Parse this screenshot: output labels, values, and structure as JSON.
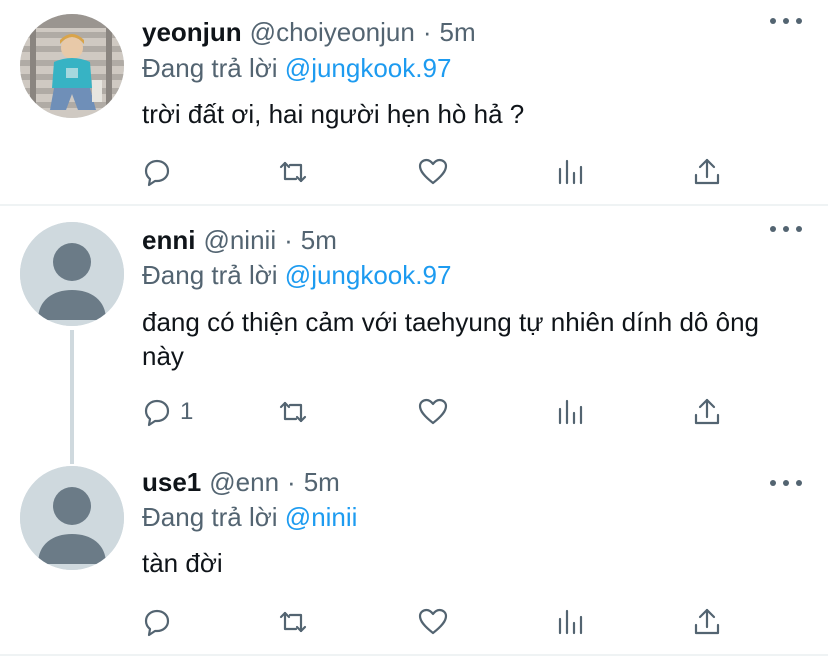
{
  "tweets": [
    {
      "name": "yeonjun",
      "handle": "@choiyeonjun",
      "separator": "·",
      "time": "5m",
      "replying_prefix": "Đang trả lời",
      "replying_to": "@jungkook.97",
      "text": "trời đất ơi, hai người hẹn hò hả ?",
      "reply_count": ""
    },
    {
      "name": "enni",
      "handle": "@ninii",
      "separator": "·",
      "time": "5m",
      "replying_prefix": "Đang trả lời",
      "replying_to": "@jungkook.97",
      "text": "đang có thiện cảm với taehyung tự nhiên dính dô ông này",
      "reply_count": "1"
    },
    {
      "name": "use1",
      "handle": "@enn",
      "separator": "·",
      "time": "5m",
      "replying_prefix": "Đang trả lời",
      "replying_to": "@ninii",
      "text": "tàn đời",
      "reply_count": ""
    }
  ],
  "icons": {
    "reply": "reply-icon",
    "retweet": "retweet-icon",
    "like": "heart-icon",
    "analytics": "analytics-icon",
    "share": "share-icon",
    "more": "more-icon"
  },
  "colors": {
    "mention": "#1d9bf0",
    "secondary": "#536471",
    "primary_text": "#0f1419",
    "avatar_placeholder": "#cfd9de"
  }
}
